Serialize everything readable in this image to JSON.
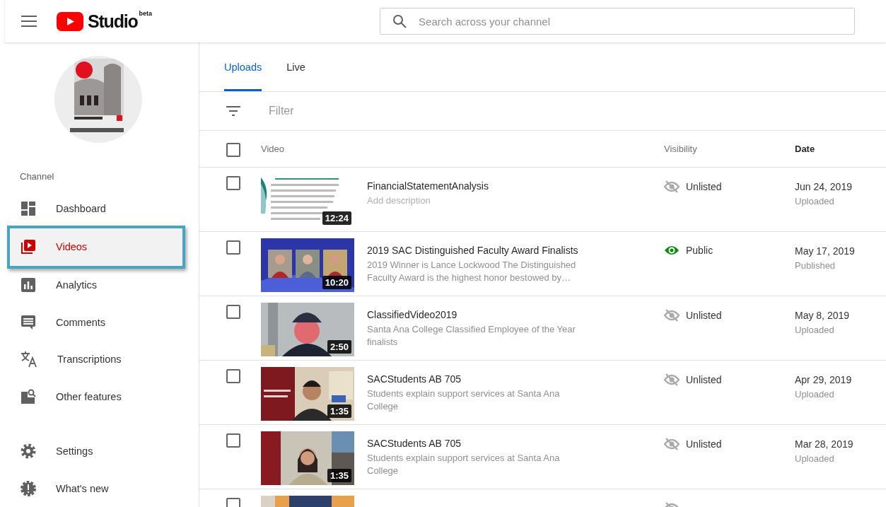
{
  "header": {
    "logo_text": "Studio",
    "logo_badge": "beta",
    "search": {
      "placeholder": "Search across your channel"
    }
  },
  "sidebar": {
    "section_label": "Channel",
    "items": [
      {
        "label": "Dashboard",
        "selected": false
      },
      {
        "label": "Videos",
        "selected": true
      },
      {
        "label": "Analytics",
        "selected": false
      },
      {
        "label": "Comments",
        "selected": false
      },
      {
        "label": "Transcriptions",
        "selected": false
      },
      {
        "label": "Other features",
        "selected": false
      }
    ],
    "footer_items": [
      {
        "label": "Settings",
        "selected": false
      },
      {
        "label": "What's new",
        "selected": false
      }
    ]
  },
  "tabs": [
    {
      "label": "Uploads",
      "selected": true
    },
    {
      "label": "Live",
      "selected": false
    }
  ],
  "filter": {
    "placeholder": "Filter"
  },
  "table": {
    "select_all_checked": false,
    "columns": [
      {
        "label": "Video",
        "sorted": false
      },
      {
        "label": "Visibility",
        "sorted": false
      },
      {
        "label": "Date",
        "sorted": true
      }
    ],
    "rows": [
      {
        "checked": false,
        "thumbnail": {
          "kind": "picture",
          "duration": "12:24"
        },
        "title": "FinancialStatementAnalysis",
        "description_placeholder": "Add description",
        "visibility": {
          "kind": "unlisted",
          "label": "Unlisted"
        },
        "date": "Jun 24, 2019",
        "status": "Uploaded"
      },
      {
        "checked": false,
        "thumbnail": {
          "kind": "picture",
          "duration": "10:20"
        },
        "title": "2019 SAC Distinguished Faculty Award Finalists",
        "description": "2019 Winner is Lance Lockwood The Distinguished Faculty Award is the highest honor bestowed by…",
        "visibility": {
          "kind": "public",
          "label": "Public"
        },
        "date": "May 17, 2019",
        "status": "Published"
      },
      {
        "checked": false,
        "thumbnail": {
          "kind": "picture",
          "duration": "2:50"
        },
        "title": "ClassifiedVideo2019",
        "description": "Santa Ana College Classified Employee of the Year finalists",
        "visibility": {
          "kind": "unlisted",
          "label": "Unlisted"
        },
        "date": "May 8, 2019",
        "status": "Uploaded"
      },
      {
        "checked": false,
        "thumbnail": {
          "kind": "picture",
          "duration": "1:35"
        },
        "title": "SACStudents AB 705",
        "description": "Students explain support services at Santa Ana College",
        "visibility": {
          "kind": "unlisted",
          "label": "Unlisted"
        },
        "date": "Apr 29, 2019",
        "status": "Uploaded"
      },
      {
        "checked": false,
        "thumbnail": {
          "kind": "picture",
          "duration": "1:35"
        },
        "title": "SACStudents AB 705",
        "description": "Students explain support services at Santa Ana College",
        "visibility": {
          "kind": "unlisted",
          "label": "Unlisted"
        },
        "date": "Mar 28, 2019",
        "status": "Uploaded"
      },
      {
        "checked": false,
        "visibility": {
          "kind": "unlisted"
        }
      }
    ]
  }
}
